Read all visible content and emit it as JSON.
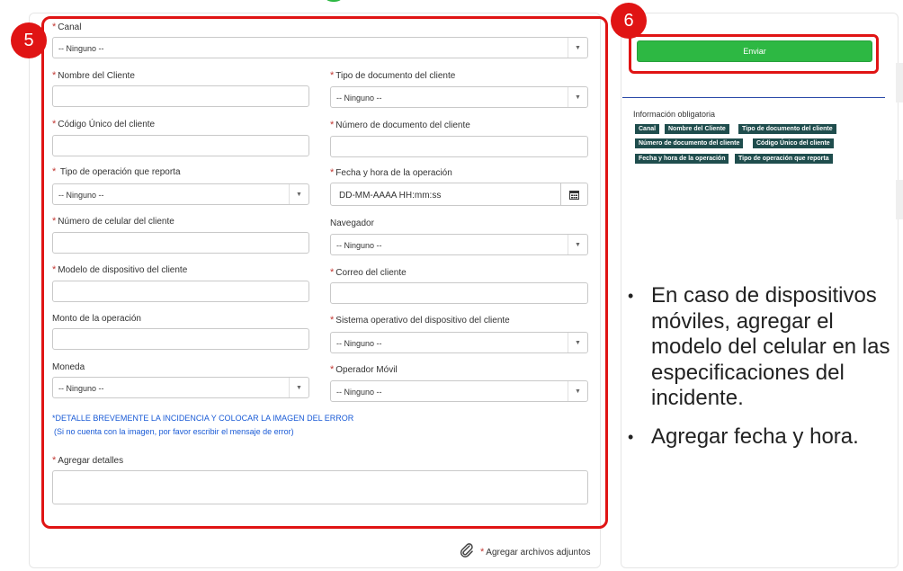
{
  "badges": {
    "form": "5",
    "submit": "6"
  },
  "form": {
    "fields": {
      "canal": {
        "label": "Canal",
        "value": "-- Ninguno --"
      },
      "nombre_cliente": {
        "label": "Nombre del Cliente"
      },
      "tipo_documento": {
        "label": "Tipo de documento del cliente",
        "value": "-- Ninguno --"
      },
      "codigo_unico": {
        "label": "Código Único del cliente"
      },
      "numero_documento": {
        "label": "Número de documento del cliente"
      },
      "tipo_operacion": {
        "label": "Tipo de operación que reporta",
        "value": "-- Ninguno --"
      },
      "fecha_hora": {
        "label": "Fecha y hora de la operación",
        "placeholder": "DD-MM-AAAA HH:mm:ss"
      },
      "numero_celular": {
        "label": "Número de celular del cliente"
      },
      "navegador": {
        "label": "Navegador",
        "value": "-- Ninguno --"
      },
      "modelo_dispositivo": {
        "label": "Modelo de dispositivo del cliente"
      },
      "correo": {
        "label": "Correo del cliente"
      },
      "monto": {
        "label": "Monto de la operación"
      },
      "sistema_operativo": {
        "label": "Sistema operativo del dispositivo del cliente",
        "value": "-- Ninguno --"
      },
      "moneda": {
        "label": "Moneda",
        "value": "-- Ninguno --"
      },
      "operador_movil": {
        "label": "Operador Móvil",
        "value": "-- Ninguno --"
      }
    },
    "note_line1": "*DETALLE BREVEMENTE LA INCIDENCIA Y COLOCAR LA IMAGEN DEL ERROR",
    "note_line2": "(Si no cuenta con la imagen, por favor escribir el mensaje de error)",
    "detalles": {
      "label": "Agregar detalles"
    },
    "attachments_label": "Agregar archivos adjuntos",
    "required_mark": "*"
  },
  "sidebar": {
    "submit_label": "Enviar",
    "info_title": "Información obligatoria",
    "required_tags": [
      "Canal",
      "Nombre del Cliente",
      "Tipo de documento del cliente",
      "Número de documento del cliente",
      "Código Único del cliente",
      "Fecha y hora de la operación",
      "Tipo de operación que reporta"
    ]
  },
  "annotations": {
    "bullet_symbol": "•",
    "bullet1": "En caso de dispositivos móviles, agregar el modelo del celular en las especificaciones del incidente.",
    "bullet2": "Agregar fecha y hora."
  },
  "colors": {
    "accent_green": "#2db843",
    "highlight_red": "#e01414",
    "tag_bg": "#1f4d4d",
    "link_blue": "#1a5bd6"
  },
  "icons": {
    "caret": "chevron-down-icon",
    "calendar": "calendar-icon",
    "attach": "paperclip-icon"
  }
}
